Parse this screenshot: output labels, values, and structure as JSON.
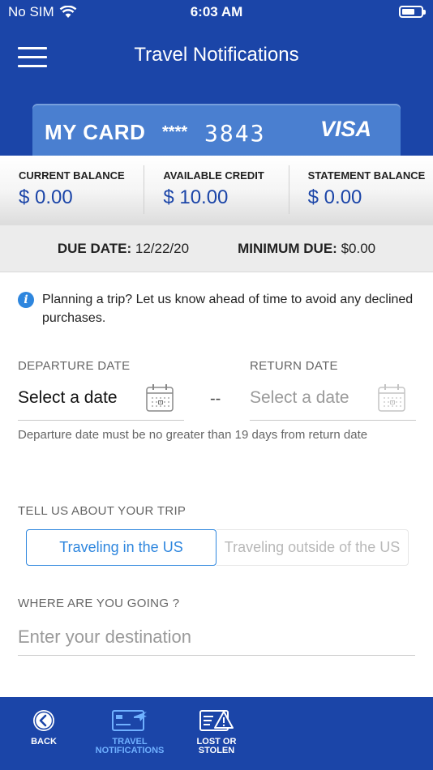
{
  "status_bar": {
    "carrier": "No SIM",
    "time": "6:03 AM",
    "battery_level": 0.7
  },
  "header": {
    "title": "Travel Notifications"
  },
  "card": {
    "name": "MY CARD",
    "masked": "****",
    "last4": "3843",
    "brand": "VISA"
  },
  "balances": [
    {
      "label": "CURRENT BALANCE",
      "value": "$ 0.00"
    },
    {
      "label": "AVAILABLE CREDIT",
      "value": "$ 10.00"
    },
    {
      "label": "STATEMENT BALANCE",
      "value": "$ 0.00"
    }
  ],
  "due": {
    "due_label": "DUE DATE:",
    "due_value": "12/22/20",
    "min_label": "MINIMUM DUE:",
    "min_value": "$0.00"
  },
  "info_text": "Planning a trip? Let us know ahead of time to avoid any declined purchases.",
  "departure": {
    "label": "DEPARTURE DATE",
    "value": "Select a date"
  },
  "return": {
    "label": "RETURN DATE",
    "placeholder": "Select a date"
  },
  "separator": "--",
  "hint": "Departure date must be no greater than 19 days from return date",
  "trip": {
    "label": "TELL US ABOUT YOUR TRIP",
    "options": [
      "Traveling in the US",
      "Traveling outside of the US"
    ],
    "selected": "Traveling in the US"
  },
  "destination": {
    "label": "WHERE ARE YOU GOING ?",
    "placeholder": "Enter your destination"
  },
  "nav": [
    {
      "label": "BACK"
    },
    {
      "label_line1": "TRAVEL",
      "label_line2": "NOTIFICATIONS"
    },
    {
      "label_line1": "LOST OR",
      "label_line2": "STOLEN"
    }
  ],
  "colors": {
    "header_bg": "#1b45a8",
    "accent": "#2e86de",
    "card_bg": "#4a7fd0",
    "nav_active": "#6fb0ff"
  }
}
